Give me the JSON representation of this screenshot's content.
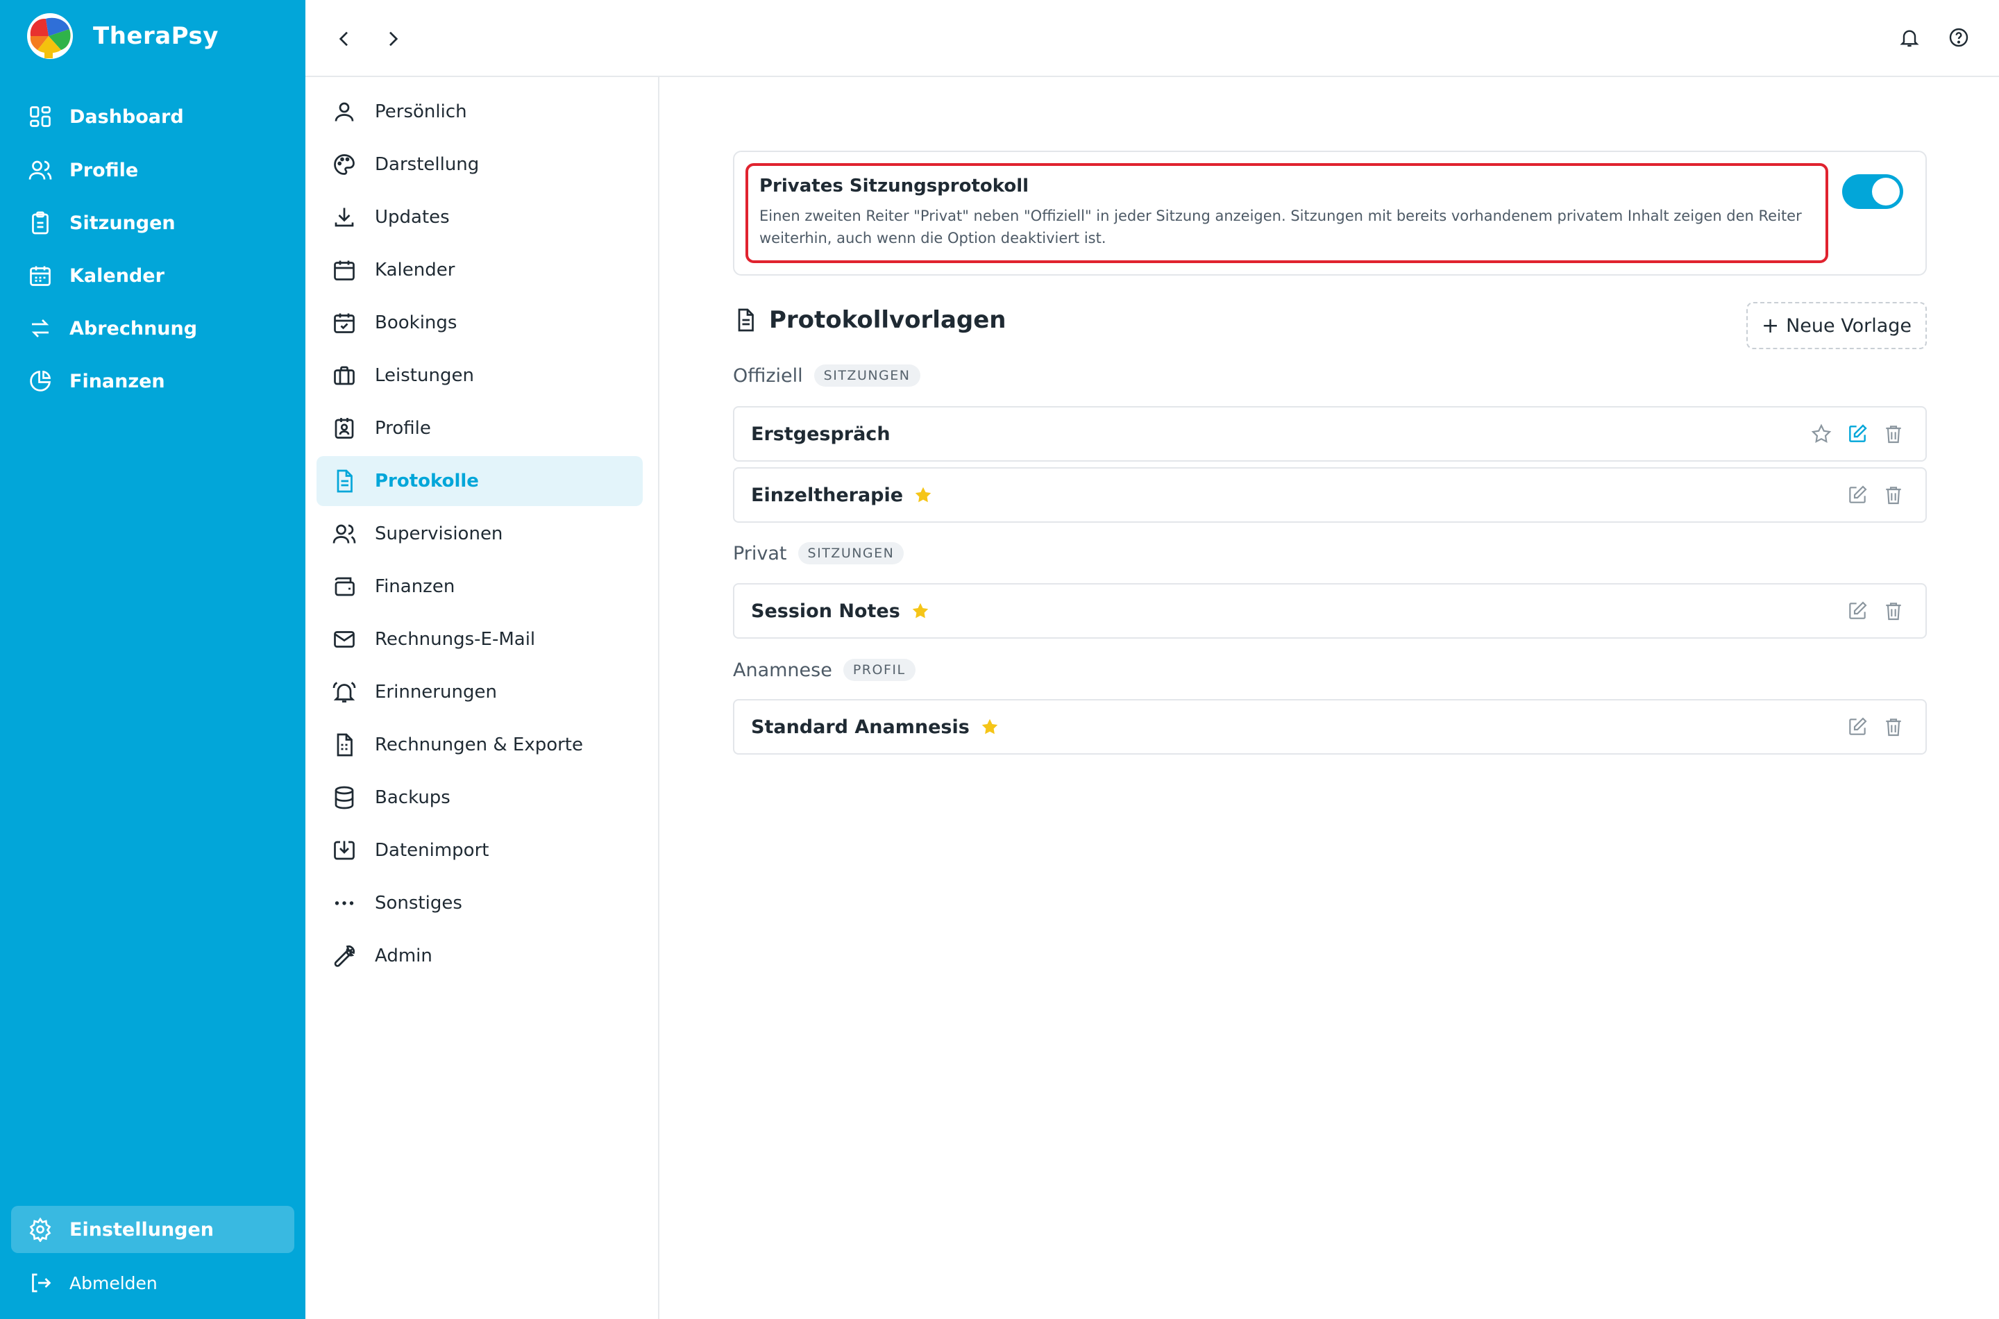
{
  "app": {
    "name": "TheraPsy"
  },
  "sidebar": {
    "items": [
      {
        "label": "Dashboard",
        "icon": "dashboard-icon"
      },
      {
        "label": "Profile",
        "icon": "users-icon"
      },
      {
        "label": "Sitzungen",
        "icon": "clipboard-icon"
      },
      {
        "label": "Kalender",
        "icon": "calendar-icon"
      },
      {
        "label": "Abrechnung",
        "icon": "arrows-exchange-icon"
      },
      {
        "label": "Finanzen",
        "icon": "pie-chart-icon"
      }
    ],
    "settings_label": "Einstellungen",
    "logout_label": "Abmelden"
  },
  "settings_nav": {
    "items": [
      {
        "label": "Persönlich",
        "icon": "user-icon"
      },
      {
        "label": "Darstellung",
        "icon": "palette-icon"
      },
      {
        "label": "Updates",
        "icon": "download-icon"
      },
      {
        "label": "Kalender",
        "icon": "calendar-icon"
      },
      {
        "label": "Bookings",
        "icon": "calendar-check-icon"
      },
      {
        "label": "Leistungen",
        "icon": "briefcase-icon"
      },
      {
        "label": "Profile",
        "icon": "contact-card-icon"
      },
      {
        "label": "Protokolle",
        "icon": "document-icon",
        "active": true
      },
      {
        "label": "Supervisionen",
        "icon": "users-icon"
      },
      {
        "label": "Finanzen",
        "icon": "wallet-icon"
      },
      {
        "label": "Rechnungs-E-Mail",
        "icon": "mail-icon"
      },
      {
        "label": "Erinnerungen",
        "icon": "bell-ring-icon"
      },
      {
        "label": "Rechnungen & Exporte",
        "icon": "file-spreadsheet-icon"
      },
      {
        "label": "Backups",
        "icon": "database-icon"
      },
      {
        "label": "Datenimport",
        "icon": "import-icon"
      },
      {
        "label": "Sonstiges",
        "icon": "more-horizontal-icon"
      },
      {
        "label": "Admin",
        "icon": "wrench-icon"
      }
    ]
  },
  "private_protocol": {
    "title": "Privates Sitzungsprotokoll",
    "description": "Einen zweiten Reiter \"Privat\" neben \"Offiziell\" in jeder Sitzung anzeigen. Sitzungen mit bereits vorhandenem privatem Inhalt zeigen den Reiter weiterhin, auch wenn die Option deaktiviert ist.",
    "enabled": true
  },
  "templates": {
    "title": "Protokollvorlagen",
    "new_button": "Neue Vorlage",
    "groups": [
      {
        "name": "Offiziell",
        "badge": "SITZUNGEN",
        "items": [
          {
            "name": "Erstgespräch",
            "favorite": false
          },
          {
            "name": "Einzeltherapie",
            "favorite": true
          }
        ]
      },
      {
        "name": "Privat",
        "badge": "SITZUNGEN",
        "items": [
          {
            "name": "Session Notes",
            "favorite": true
          }
        ]
      },
      {
        "name": "Anamnese",
        "badge": "PROFIL",
        "items": [
          {
            "name": "Standard Anamnesis",
            "favorite": true
          }
        ]
      }
    ]
  },
  "colors": {
    "brand": "#02a6d9",
    "highlight": "#e0232f",
    "star": "#f5c518"
  }
}
